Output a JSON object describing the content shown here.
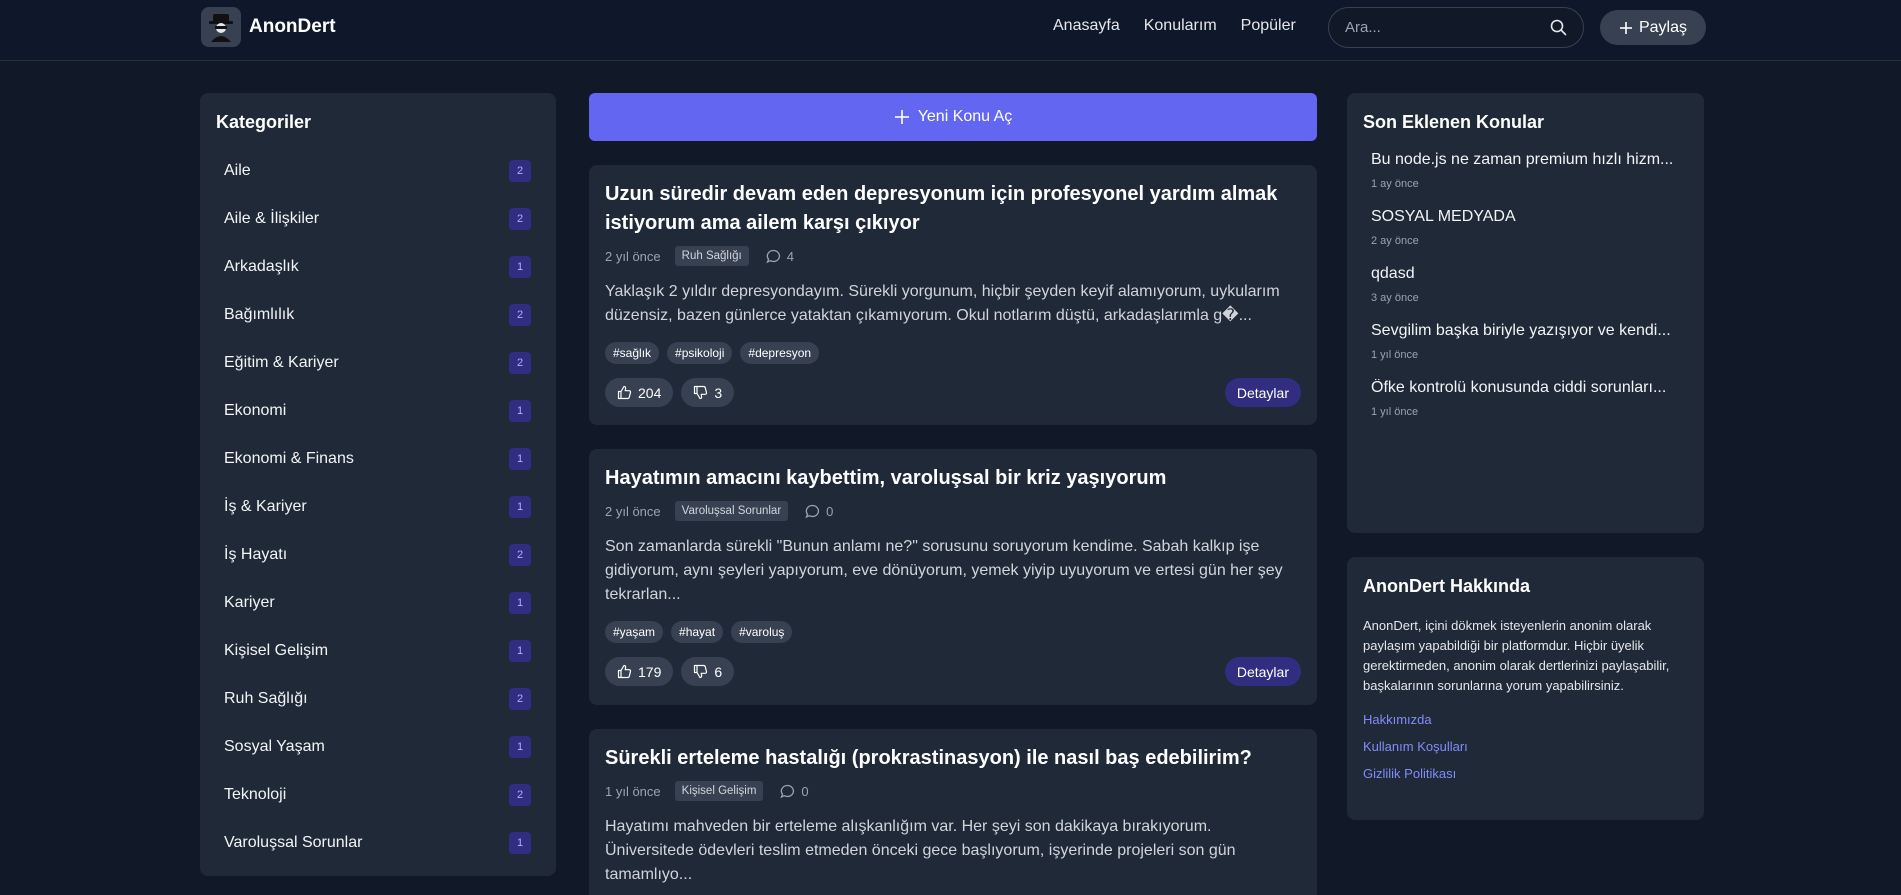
{
  "header": {
    "logo_text": "AnonDert",
    "nav": [
      "Anasayfa",
      "Konularım",
      "Popüler"
    ],
    "search_placeholder": "Ara...",
    "share_label": "Paylaş"
  },
  "categories": {
    "title": "Kategoriler",
    "items": [
      {
        "name": "Aile",
        "count": "2"
      },
      {
        "name": "Aile & İlişkiler",
        "count": "2"
      },
      {
        "name": "Arkadaşlık",
        "count": "1"
      },
      {
        "name": "Bağımlılık",
        "count": "2"
      },
      {
        "name": "Eğitim & Kariyer",
        "count": "2"
      },
      {
        "name": "Ekonomi",
        "count": "1"
      },
      {
        "name": "Ekonomi & Finans",
        "count": "1"
      },
      {
        "name": "İş & Kariyer",
        "count": "1"
      },
      {
        "name": "İş Hayatı",
        "count": "2"
      },
      {
        "name": "Kariyer",
        "count": "1"
      },
      {
        "name": "Kişisel Gelişim",
        "count": "1"
      },
      {
        "name": "Ruh Sağlığı",
        "count": "2"
      },
      {
        "name": "Sosyal Yaşam",
        "count": "1"
      },
      {
        "name": "Teknoloji",
        "count": "2"
      },
      {
        "name": "Varoluşsal Sorunlar",
        "count": "1"
      }
    ]
  },
  "main": {
    "new_topic_label": "Yeni Konu Aç",
    "posts": [
      {
        "title": "Uzun süredir devam eden depresyonum için profesyonel yardım almak istiyorum ama ailem karşı çıkıyor",
        "time": "2 yıl önce",
        "category": "Ruh Sağlığı",
        "comments": "4",
        "excerpt": "Yaklaşık 2 yıldır depresyondayım. Sürekli yorgunum, hiçbir şeyden keyif alamıyorum, uykularım düzensiz, bazen günlerce yataktan çıkamıyorum. Okul notlarım düştü, arkadaşlarımla g�...",
        "tags": [
          "#sağlık",
          "#psikoloji",
          "#depresyon"
        ],
        "likes": "204",
        "dislikes": "3",
        "details_label": "Detaylar"
      },
      {
        "title": "Hayatımın amacını kaybettim, varoluşsal bir kriz yaşıyorum",
        "time": "2 yıl önce",
        "category": "Varoluşsal Sorunlar",
        "comments": "0",
        "excerpt": "Son zamanlarda sürekli \"Bunun anlamı ne?\" sorusunu soruyorum kendime. Sabah kalkıp işe gidiyorum, aynı şeyleri yapıyorum, eve dönüyorum, yemek yiyip uyuyorum ve ertesi gün her şey tekrarlan...",
        "tags": [
          "#yaşam",
          "#hayat",
          "#varoluş"
        ],
        "likes": "179",
        "dislikes": "6",
        "details_label": "Detaylar"
      },
      {
        "title": "Sürekli erteleme hastalığı (prokrastinasyon) ile nasıl baş edebilirim?",
        "time": "1 yıl önce",
        "category": "Kişisel Gelişim",
        "comments": "0",
        "excerpt": "Hayatımı mahveden bir erteleme alışkanlığım var. Her şeyi son dakikaya bırakıyorum. Üniversitede ödevleri teslim etmeden önceki gece başlıyorum, işyerinde projeleri son gün tamamlıyo..."
      }
    ]
  },
  "recent": {
    "title": "Son Eklenen Konular",
    "items": [
      {
        "title": "Bu node.js ne zaman premium hızlı hizm...",
        "time": "1 ay önce"
      },
      {
        "title": "SOSYAL MEDYADA",
        "time": "2 ay önce"
      },
      {
        "title": "qdasd",
        "time": "3 ay önce"
      },
      {
        "title": "Sevgilim başka biriyle yazışıyor ve kendi...",
        "time": "1 yıl önce"
      },
      {
        "title": "Öfke kontrolü konusunda ciddi sorunları...",
        "time": "1 yıl önce"
      }
    ]
  },
  "about": {
    "title": "AnonDert Hakkında",
    "text": "AnonDert, içini dökmek isteyenlerin anonim olarak paylaşım yapabildiği bir platformdur. Hiçbir üyelik gerektirmeden, anonim olarak dertlerinizi paylaşabilir, başkalarının sorunlarına yorum yapabilirsiniz.",
    "links": [
      "Hakkımızda",
      "Kullanım Koşulları",
      "Gizlilik Politikası"
    ]
  },
  "colors": {
    "accent": "#6366f1",
    "background": "#111827",
    "card": "#1f2937",
    "link": "#818cf8"
  }
}
